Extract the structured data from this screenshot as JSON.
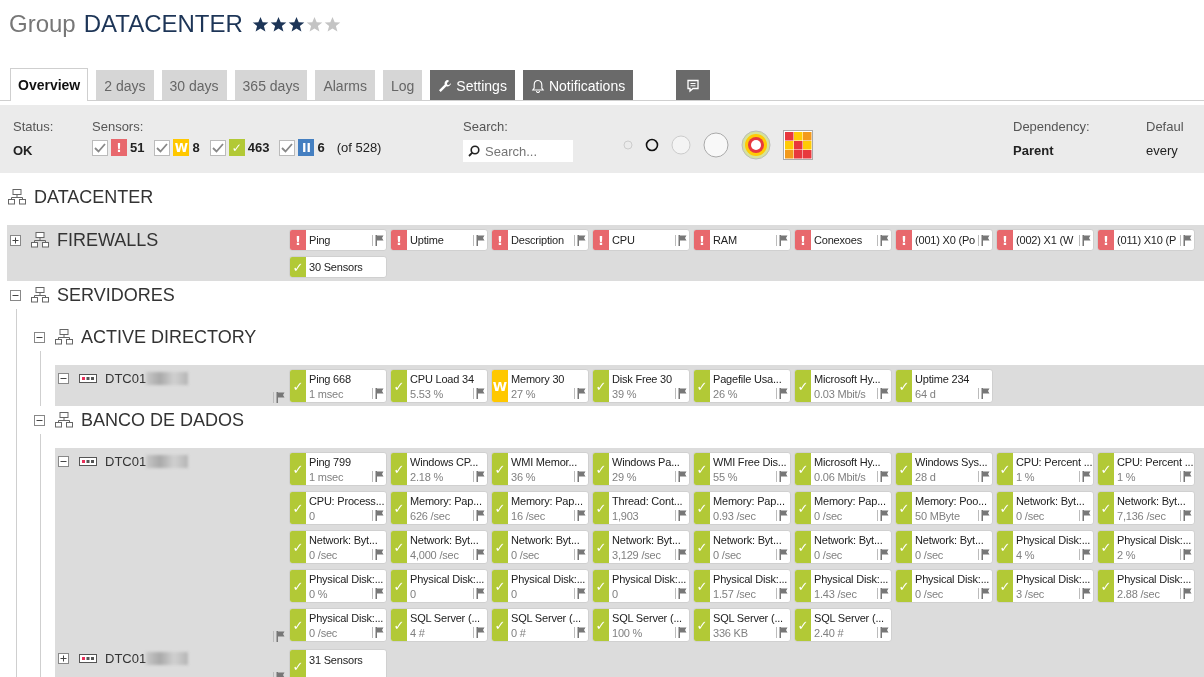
{
  "page": {
    "kind_label": "Group",
    "title": "DATACENTER",
    "stars": 3
  },
  "tabs": [
    {
      "label": "Overview",
      "kind": "plain",
      "selected": true
    },
    {
      "label": "2 days",
      "kind": "plain",
      "selected": false
    },
    {
      "label": "30 days",
      "kind": "plain",
      "selected": false
    },
    {
      "label": "365 days",
      "kind": "plain",
      "selected": false
    },
    {
      "label": "Alarms",
      "kind": "plain",
      "selected": false
    },
    {
      "label": "Log",
      "kind": "plain",
      "selected": false
    },
    {
      "label": "Settings",
      "kind": "settings",
      "selected": false
    },
    {
      "label": "Notifications",
      "kind": "notifications",
      "selected": false
    },
    {
      "kind": "comment",
      "selected": false
    }
  ],
  "status": {
    "label": "Status:",
    "value": "OK"
  },
  "sensor_filters": {
    "label": "Sensors:",
    "total": "(of 528)",
    "items": [
      {
        "color": "#e8686d",
        "glyph": "!",
        "count": "51",
        "checked": true
      },
      {
        "color": "#ffc800",
        "glyph": "W",
        "count": "8",
        "checked": true
      },
      {
        "color": "#b2c936",
        "glyph": "✓",
        "count": "463",
        "checked": true
      },
      {
        "color": "#447fc1",
        "glyph": "II",
        "count": "6",
        "checked": true
      }
    ]
  },
  "search": {
    "label": "Search:",
    "placeholder": "Search..."
  },
  "dependency": {
    "label": "Dependency:",
    "value": "Parent"
  },
  "default": {
    "label": "Defaul",
    "value": "every"
  },
  "tree": {
    "name": "DATACENTER",
    "kind": "group",
    "children": [
      {
        "name": "FIREWALLS",
        "kind": "group",
        "expanded": false,
        "sensors": [
          {
            "kind": "sensor",
            "color": "#e8686d",
            "glyph": "!",
            "name": "Ping"
          },
          {
            "kind": "sensor",
            "color": "#e8686d",
            "glyph": "!",
            "name": "Uptime"
          },
          {
            "kind": "sensor",
            "color": "#e8686d",
            "glyph": "!",
            "name": "Description"
          },
          {
            "kind": "sensor",
            "color": "#e8686d",
            "glyph": "!",
            "name": "CPU"
          },
          {
            "kind": "sensor",
            "color": "#e8686d",
            "glyph": "!",
            "name": "RAM"
          },
          {
            "kind": "sensor",
            "color": "#e8686d",
            "glyph": "!",
            "name": "Conexoes"
          },
          {
            "kind": "sensor",
            "color": "#e8686d",
            "glyph": "!",
            "name": "(001) X0 (Po"
          },
          {
            "kind": "sensor",
            "color": "#e8686d",
            "glyph": "!",
            "name": "(002) X1 (W"
          },
          {
            "kind": "sensor",
            "color": "#e8686d",
            "glyph": "!",
            "name": "(011) X10 (P"
          },
          {
            "kind": "summary",
            "color": "#b2c936",
            "glyph": "✓",
            "name": "30 Sensors"
          }
        ]
      },
      {
        "name": "SERVIDORES",
        "kind": "group",
        "expanded": true,
        "children": [
          {
            "name": "ACTIVE DIRECTORY",
            "kind": "group",
            "expanded": true,
            "children": [
              {
                "name": "DTC01",
                "kind": "device",
                "expanded": true,
                "redacted": true,
                "sensors": [
                  {
                    "kind": "sensor",
                    "color": "#b2c936",
                    "glyph": "✓",
                    "name": "Ping 668",
                    "value": "1 msec"
                  },
                  {
                    "kind": "sensor",
                    "color": "#b2c936",
                    "glyph": "✓",
                    "name": "CPU Load 34",
                    "value": "5.53 %"
                  },
                  {
                    "kind": "sensor",
                    "color": "#ffc800",
                    "glyph": "W",
                    "name": "Memory 30",
                    "value": "27 %"
                  },
                  {
                    "kind": "sensor",
                    "color": "#b2c936",
                    "glyph": "✓",
                    "name": "Disk Free 30",
                    "value": "39 %"
                  },
                  {
                    "kind": "sensor",
                    "color": "#b2c936",
                    "glyph": "✓",
                    "name": "Pagefile Usa...",
                    "value": "26 %"
                  },
                  {
                    "kind": "sensor",
                    "color": "#b2c936",
                    "glyph": "✓",
                    "name": "Microsoft Hy...",
                    "value": "0.03 Mbit/s"
                  },
                  {
                    "kind": "sensor",
                    "color": "#b2c936",
                    "glyph": "✓",
                    "name": "Uptime 234",
                    "value": "64 d"
                  }
                ]
              }
            ]
          },
          {
            "name": "BANCO DE DADOS",
            "kind": "group",
            "expanded": true,
            "children": [
              {
                "name": "DTC01",
                "kind": "device",
                "expanded": true,
                "redacted": true,
                "sensors": [
                  {
                    "kind": "sensor",
                    "color": "#b2c936",
                    "glyph": "✓",
                    "name": "Ping 799",
                    "value": "1 msec"
                  },
                  {
                    "kind": "sensor",
                    "color": "#b2c936",
                    "glyph": "✓",
                    "name": "Windows CP...",
                    "value": "2.18 %"
                  },
                  {
                    "kind": "sensor",
                    "color": "#b2c936",
                    "glyph": "✓",
                    "name": "WMI Memor...",
                    "value": "36 %"
                  },
                  {
                    "kind": "sensor",
                    "color": "#b2c936",
                    "glyph": "✓",
                    "name": "Windows Pa...",
                    "value": "29 %"
                  },
                  {
                    "kind": "sensor",
                    "color": "#b2c936",
                    "glyph": "✓",
                    "name": "WMI Free Dis...",
                    "value": "55 %"
                  },
                  {
                    "kind": "sensor",
                    "color": "#b2c936",
                    "glyph": "✓",
                    "name": "Microsoft Hy...",
                    "value": "0.06 Mbit/s"
                  },
                  {
                    "kind": "sensor",
                    "color": "#b2c936",
                    "glyph": "✓",
                    "name": "Windows Sys...",
                    "value": "28 d"
                  },
                  {
                    "kind": "sensor",
                    "color": "#b2c936",
                    "glyph": "✓",
                    "name": "CPU: Percent ...",
                    "value": "1 %"
                  },
                  {
                    "kind": "sensor",
                    "color": "#b2c936",
                    "glyph": "✓",
                    "name": "CPU: Percent ...",
                    "value": "1 %"
                  },
                  {
                    "kind": "sensor",
                    "color": "#b2c936",
                    "glyph": "✓",
                    "name": "CPU: Process...",
                    "value": "0"
                  },
                  {
                    "kind": "sensor",
                    "color": "#b2c936",
                    "glyph": "✓",
                    "name": "Memory: Pap...",
                    "value": "626 /sec"
                  },
                  {
                    "kind": "sensor",
                    "color": "#b2c936",
                    "glyph": "✓",
                    "name": "Memory: Pap...",
                    "value": "16 /sec"
                  },
                  {
                    "kind": "sensor",
                    "color": "#b2c936",
                    "glyph": "✓",
                    "name": "Thread: Cont...",
                    "value": "1,903"
                  },
                  {
                    "kind": "sensor",
                    "color": "#b2c936",
                    "glyph": "✓",
                    "name": "Memory: Pap...",
                    "value": "0.93 /sec"
                  },
                  {
                    "kind": "sensor",
                    "color": "#b2c936",
                    "glyph": "✓",
                    "name": "Memory: Pap...",
                    "value": "0 /sec"
                  },
                  {
                    "kind": "sensor",
                    "color": "#b2c936",
                    "glyph": "✓",
                    "name": "Memory: Poo...",
                    "value": "50 MByte"
                  },
                  {
                    "kind": "sensor",
                    "color": "#b2c936",
                    "glyph": "✓",
                    "name": "Network: Byt...",
                    "value": "0 /sec"
                  },
                  {
                    "kind": "sensor",
                    "color": "#b2c936",
                    "glyph": "✓",
                    "name": "Network: Byt...",
                    "value": "7,136 /sec"
                  },
                  {
                    "kind": "sensor",
                    "color": "#b2c936",
                    "glyph": "✓",
                    "name": "Network: Byt...",
                    "value": "0 /sec"
                  },
                  {
                    "kind": "sensor",
                    "color": "#b2c936",
                    "glyph": "✓",
                    "name": "Network: Byt...",
                    "value": "4,000 /sec"
                  },
                  {
                    "kind": "sensor",
                    "color": "#b2c936",
                    "glyph": "✓",
                    "name": "Network: Byt...",
                    "value": "0 /sec"
                  },
                  {
                    "kind": "sensor",
                    "color": "#b2c936",
                    "glyph": "✓",
                    "name": "Network: Byt...",
                    "value": "3,129 /sec"
                  },
                  {
                    "kind": "sensor",
                    "color": "#b2c936",
                    "glyph": "✓",
                    "name": "Network: Byt...",
                    "value": "0 /sec"
                  },
                  {
                    "kind": "sensor",
                    "color": "#b2c936",
                    "glyph": "✓",
                    "name": "Network: Byt...",
                    "value": "0 /sec"
                  },
                  {
                    "kind": "sensor",
                    "color": "#b2c936",
                    "glyph": "✓",
                    "name": "Network: Byt...",
                    "value": "0 /sec"
                  },
                  {
                    "kind": "sensor",
                    "color": "#b2c936",
                    "glyph": "✓",
                    "name": "Physical Disk:...",
                    "value": "4 %"
                  },
                  {
                    "kind": "sensor",
                    "color": "#b2c936",
                    "glyph": "✓",
                    "name": "Physical Disk:...",
                    "value": "2 %"
                  },
                  {
                    "kind": "sensor",
                    "color": "#b2c936",
                    "glyph": "✓",
                    "name": "Physical Disk:...",
                    "value": "0 %"
                  },
                  {
                    "kind": "sensor",
                    "color": "#b2c936",
                    "glyph": "✓",
                    "name": "Physical Disk:...",
                    "value": "0"
                  },
                  {
                    "kind": "sensor",
                    "color": "#b2c936",
                    "glyph": "✓",
                    "name": "Physical Disk:...",
                    "value": "0"
                  },
                  {
                    "kind": "sensor",
                    "color": "#b2c936",
                    "glyph": "✓",
                    "name": "Physical Disk:...",
                    "value": "0"
                  },
                  {
                    "kind": "sensor",
                    "color": "#b2c936",
                    "glyph": "✓",
                    "name": "Physical Disk:...",
                    "value": "1.57 /sec"
                  },
                  {
                    "kind": "sensor",
                    "color": "#b2c936",
                    "glyph": "✓",
                    "name": "Physical Disk:...",
                    "value": "1.43 /sec"
                  },
                  {
                    "kind": "sensor",
                    "color": "#b2c936",
                    "glyph": "✓",
                    "name": "Physical Disk:...",
                    "value": "0 /sec"
                  },
                  {
                    "kind": "sensor",
                    "color": "#b2c936",
                    "glyph": "✓",
                    "name": "Physical Disk:...",
                    "value": "3 /sec"
                  },
                  {
                    "kind": "sensor",
                    "color": "#b2c936",
                    "glyph": "✓",
                    "name": "Physical Disk:...",
                    "value": "2.88 /sec"
                  },
                  {
                    "kind": "sensor",
                    "color": "#b2c936",
                    "glyph": "✓",
                    "name": "Physical Disk:...",
                    "value": "0 /sec"
                  },
                  {
                    "kind": "sensor",
                    "color": "#b2c936",
                    "glyph": "✓",
                    "name": "SQL Server (...",
                    "value": "4 #"
                  },
                  {
                    "kind": "sensor",
                    "color": "#b2c936",
                    "glyph": "✓",
                    "name": "SQL Server (...",
                    "value": "0 #"
                  },
                  {
                    "kind": "sensor",
                    "color": "#b2c936",
                    "glyph": "✓",
                    "name": "SQL Server (...",
                    "value": "100 %"
                  },
                  {
                    "kind": "sensor",
                    "color": "#b2c936",
                    "glyph": "✓",
                    "name": "SQL Server (...",
                    "value": "336 KB"
                  },
                  {
                    "kind": "sensor",
                    "color": "#b2c936",
                    "glyph": "✓",
                    "name": "SQL Server (...",
                    "value": "2.40 #"
                  }
                ]
              },
              {
                "name": "DTC01",
                "kind": "device",
                "expanded": false,
                "redacted": true,
                "sensors": [
                  {
                    "kind": "summary",
                    "color": "#b2c936",
                    "glyph": "✓",
                    "name": "31 Sensors"
                  }
                ]
              }
            ]
          }
        ]
      }
    ]
  }
}
